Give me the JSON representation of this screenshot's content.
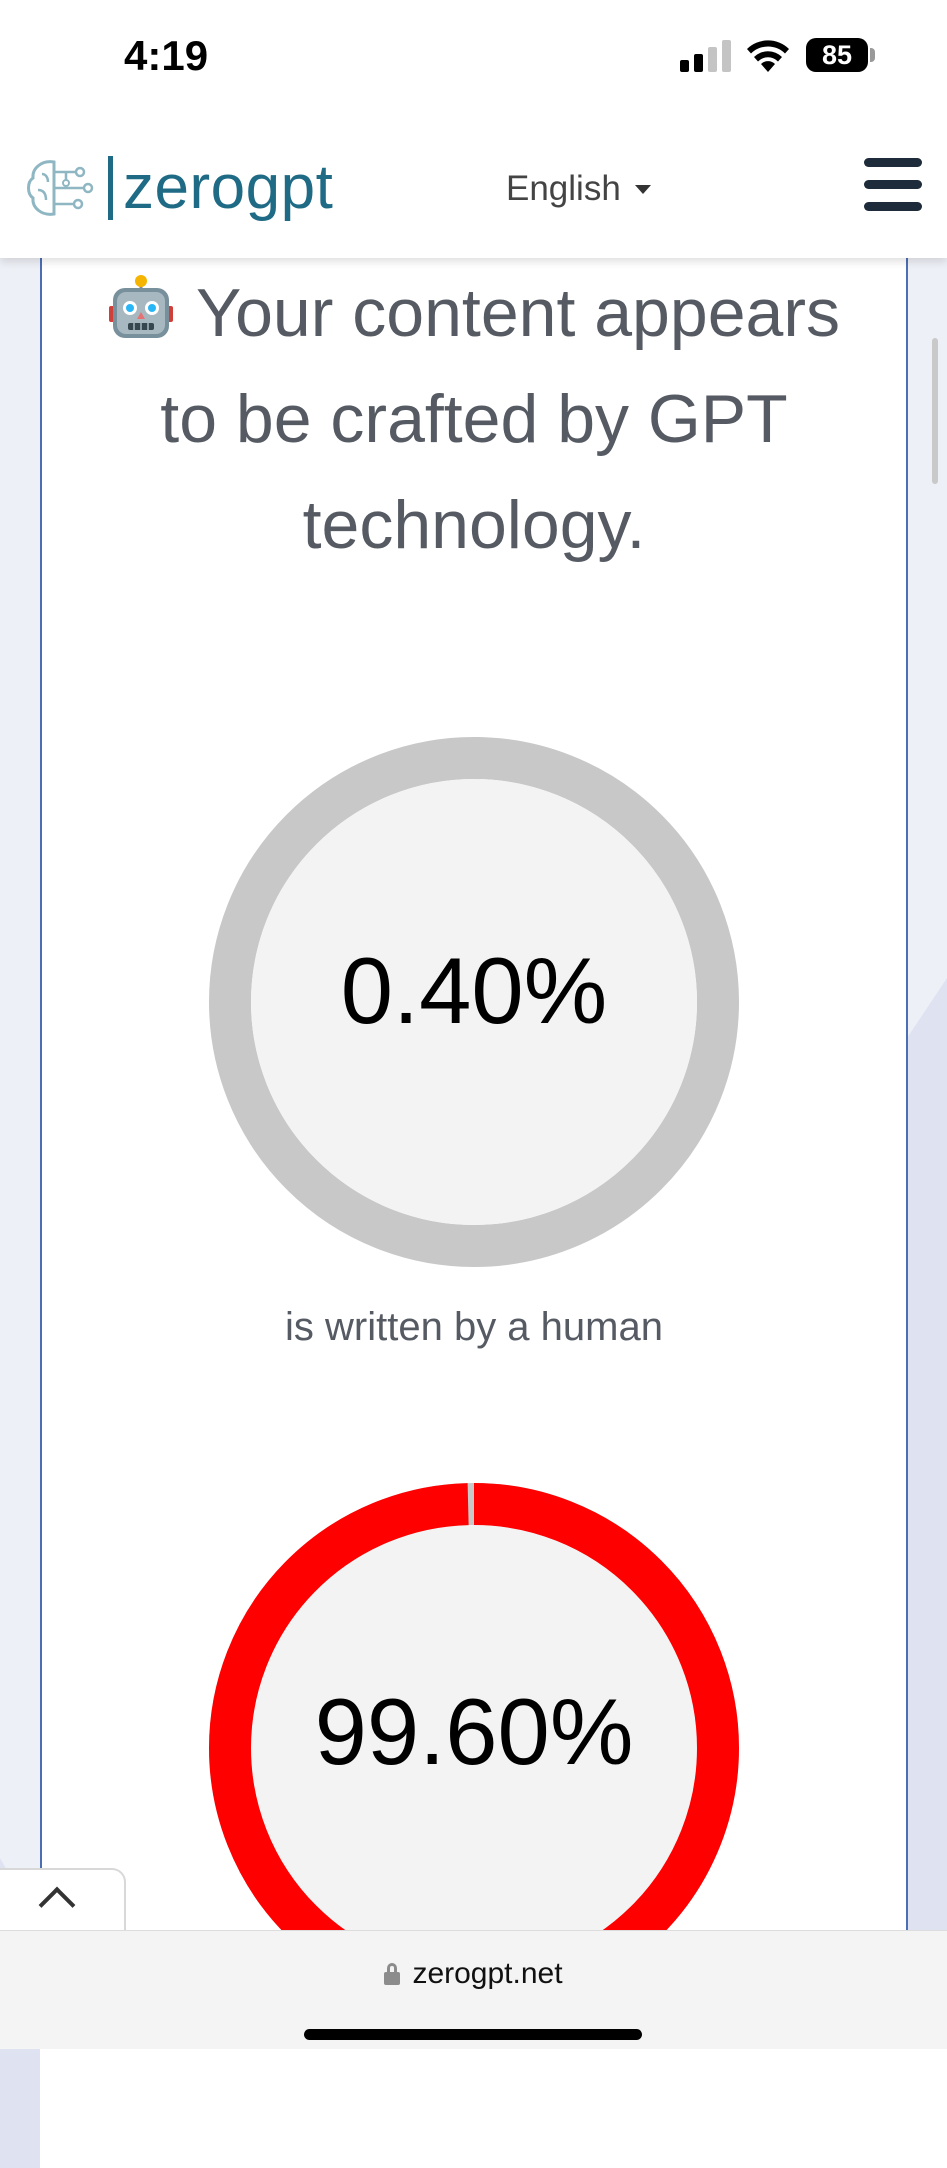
{
  "status_bar": {
    "time": "4:19",
    "battery": "85"
  },
  "header": {
    "logo_text": "zerogpt",
    "language": "English"
  },
  "result": {
    "verdict": "Your content appears to be crafted by GPT technology.",
    "robot_icon": "robot-face-icon",
    "human_percent_label": "0.40%",
    "human_percent": 0.4,
    "human_caption": "is written by a human",
    "ai_percent_label": "99.60%",
    "ai_percent": 99.6
  },
  "browser": {
    "url": "zerogpt.net"
  },
  "colors": {
    "brand": "#1f6b86",
    "gauge_track": "#c8c8c8",
    "gauge_inner": "#f3f3f3",
    "ai_red": "#ff0000",
    "card_border": "#4a6fb5"
  }
}
